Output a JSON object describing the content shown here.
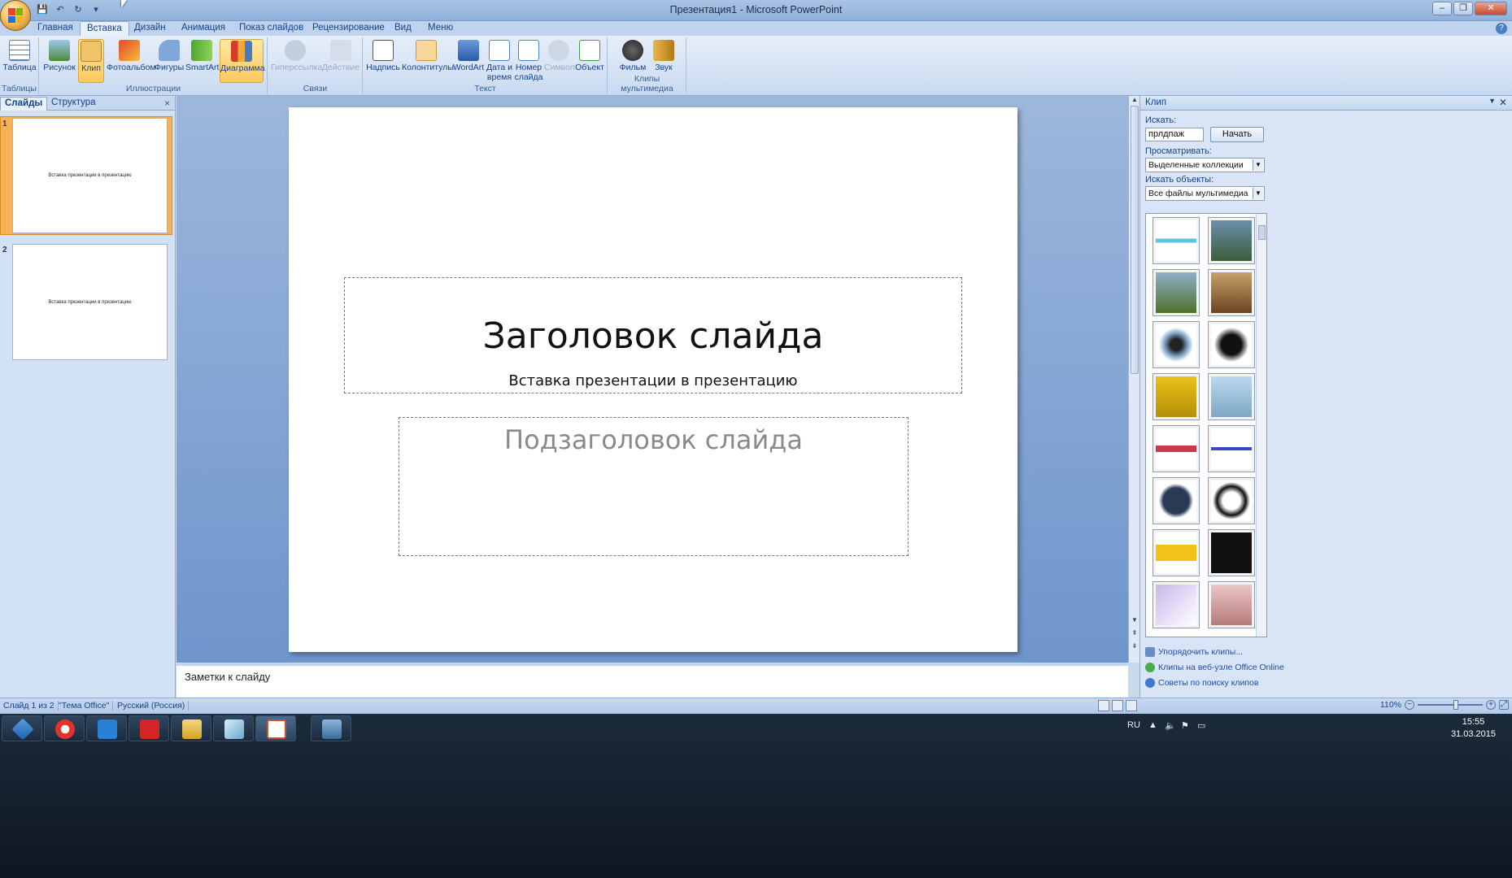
{
  "window": {
    "title": "Презентация1 - Microsoft PowerPoint",
    "min": "–",
    "max": "❐",
    "close": "✕"
  },
  "qat": {
    "save": "💾",
    "undo": "↶",
    "redo": "↻",
    "more": "▾"
  },
  "tabs": [
    "Главная",
    "Вставка",
    "Дизайн",
    "Анимация",
    "Показ слайдов",
    "Рецензирование",
    "Вид",
    "Меню"
  ],
  "help": "?",
  "ribbon": {
    "groups": [
      "Таблицы",
      "Иллюстрации",
      "Связи",
      "Текст",
      "Клипы мультимедиа"
    ],
    "buttons": {
      "table": "Таблица",
      "picture": "Рисунок",
      "clip": "Клип",
      "album": "Фотоальбом",
      "shapes": "Фигуры",
      "smartart": "SmartArt",
      "chart": "Диаграмма",
      "hyperlink": "Гиперссылка",
      "action": "Действие",
      "textbox": "Надпись",
      "headerfooter": "Колонтитулы",
      "wordart": "WordArt",
      "datetime": "Дата и время",
      "slidenum": "Номер слайда",
      "symbol": "Символ",
      "object": "Объект",
      "movie": "Фильм",
      "sound": "Звук"
    }
  },
  "thumbpanel": {
    "tab_slides": "Слайды",
    "tab_outline": "Структура",
    "close": "×",
    "slides": [
      {
        "num": "1",
        "text": "Вставка презентации в презентацию"
      },
      {
        "num": "2",
        "text": "Вставка презентации в презентацию"
      }
    ]
  },
  "slide": {
    "title": "Заголовок слайда",
    "subtitle_text": "Вставка презентации в презентацию",
    "sub_placeholder": "Подзаголовок слайда"
  },
  "notes": {
    "placeholder": "Заметки к слайду"
  },
  "taskpane": {
    "title": "Клип",
    "search_label": "Искать:",
    "search_value": "прлдпаж",
    "go": "Начать",
    "browse_label": "Просматривать:",
    "browse_value": "Выделенные коллекции",
    "types_label": "Искать объекты:",
    "types_value": "Все файлы мультимедиа",
    "links": [
      "Упорядочить клипы...",
      "Клипы на веб-узле Office Online",
      "Советы по поиску клипов"
    ]
  },
  "status": {
    "slide": "Слайд 1 из 2",
    "theme": "\"Тема Office\"",
    "lang": "Русский (Россия)",
    "zoom": "110%"
  },
  "tray": {
    "lang": "RU",
    "time": "15:55",
    "date": "31.03.2015"
  }
}
